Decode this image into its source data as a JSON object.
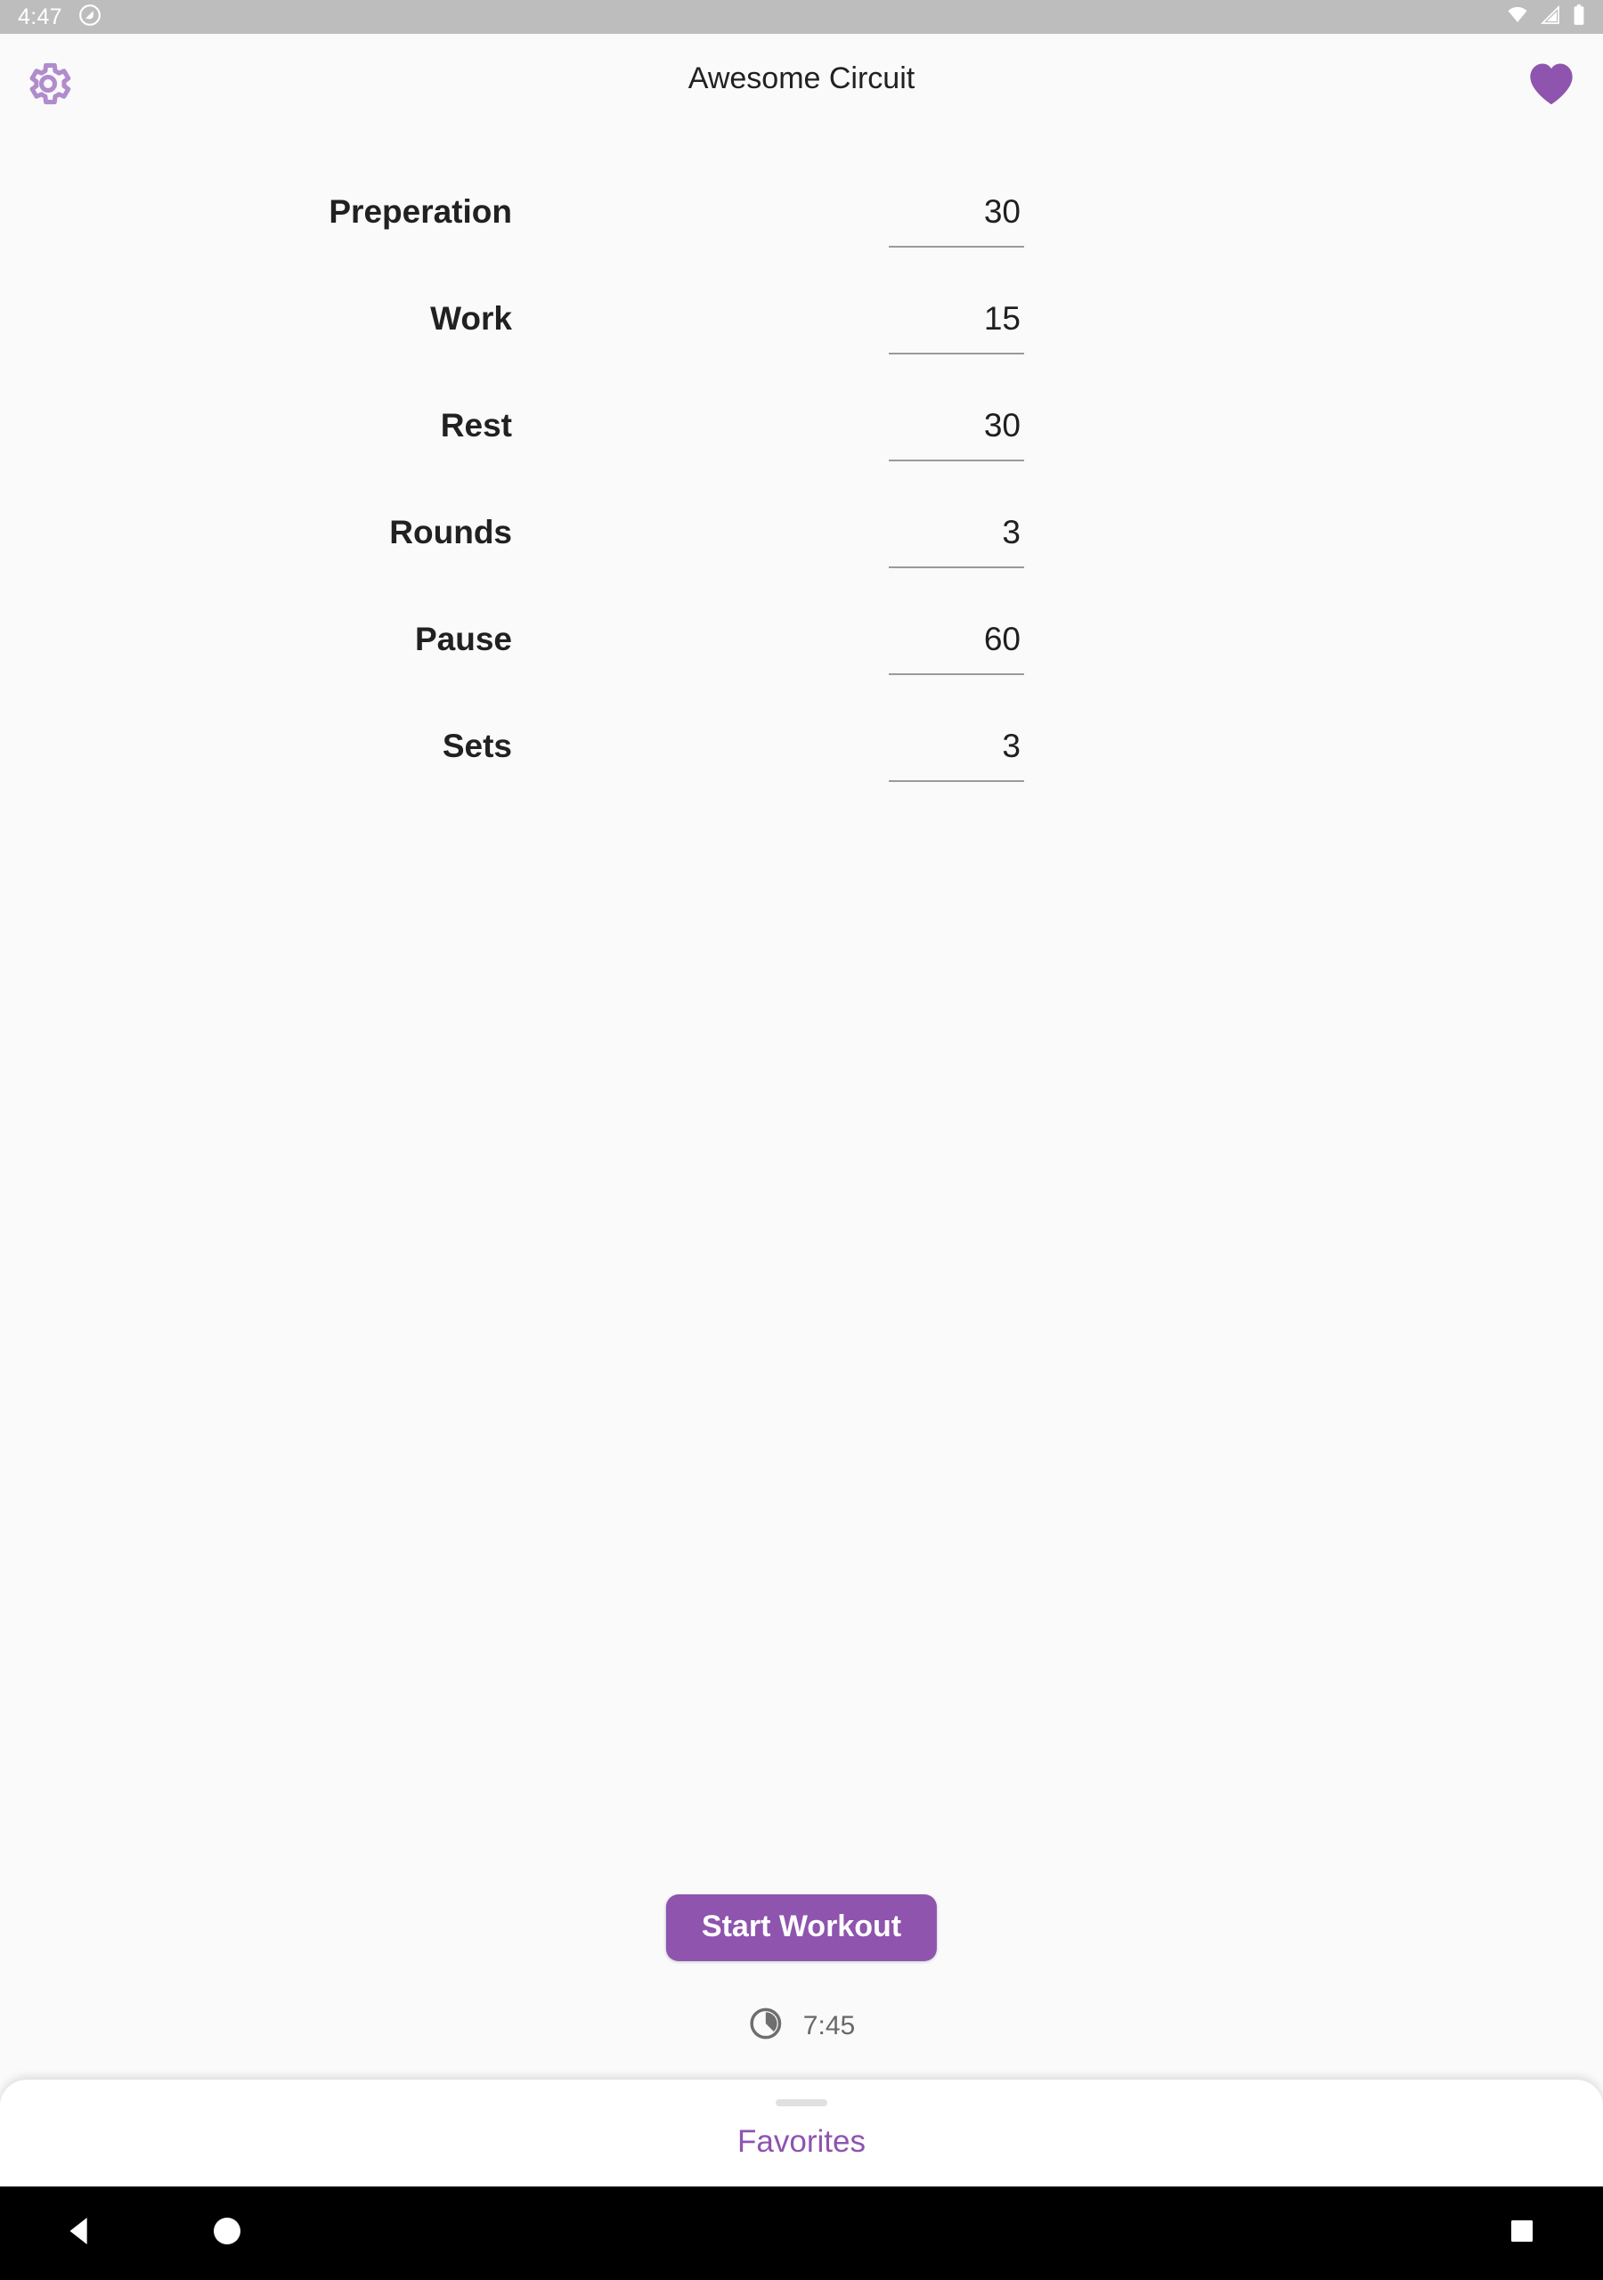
{
  "status_bar": {
    "clock": "4:47",
    "icons": [
      "do-not-disturb-icon",
      "wifi-icon",
      "cellular-signal-icon",
      "battery-icon"
    ],
    "background": "#bdbdbd"
  },
  "app_bar": {
    "title": "Awesome Circuit",
    "settings_icon": "gear-icon",
    "favorite_icon": "heart-icon",
    "accent": "#8e54ae",
    "settings_icon_color": "#b08ccd"
  },
  "settings_form": {
    "rows": [
      {
        "label": "Preperation",
        "value": "30"
      },
      {
        "label": "Work",
        "value": "15"
      },
      {
        "label": "Rest",
        "value": "30"
      },
      {
        "label": "Rounds",
        "value": "3"
      },
      {
        "label": "Pause",
        "value": "60"
      },
      {
        "label": "Sets",
        "value": "3"
      }
    ]
  },
  "actions": {
    "start_label": "Start Workout",
    "start_color": "#8e54ae"
  },
  "total_time": {
    "icon": "pie-timer-icon",
    "value": "7:45"
  },
  "favorites_sheet": {
    "label": "Favorites",
    "handle": "drag-handle",
    "label_color": "#8e54ae"
  },
  "nav_bar": {
    "back": "back-triangle-icon",
    "home": "home-circle-icon",
    "recent": "recent-apps-square-icon",
    "background": "#000000"
  }
}
